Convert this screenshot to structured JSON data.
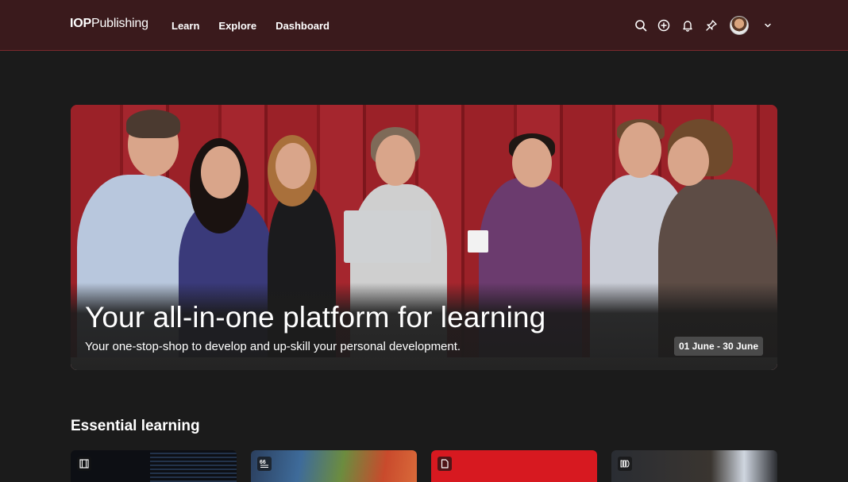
{
  "header": {
    "logo_bold": "IOP",
    "logo_light": "Publishing",
    "nav": [
      "Learn",
      "Explore",
      "Dashboard"
    ],
    "icons": [
      "search-icon",
      "add-icon",
      "bell-icon",
      "pin-icon",
      "avatar",
      "chevron-down-icon"
    ]
  },
  "hero": {
    "title": "Your all-in-one platform for learning",
    "subtitle": "Your one-stop-shop to develop and up-skill your personal development.",
    "date_range": "01 June - 30 June"
  },
  "essential": {
    "title": "Essential learning",
    "cards": [
      {
        "icon": "film-icon"
      },
      {
        "icon": "quote-icon"
      },
      {
        "icon": "document-icon"
      },
      {
        "icon": "chapters-icon"
      }
    ]
  },
  "colors": {
    "header_bg": "#3a1a1c",
    "page_bg": "#1b1b1b",
    "accent_red": "#d71920"
  }
}
